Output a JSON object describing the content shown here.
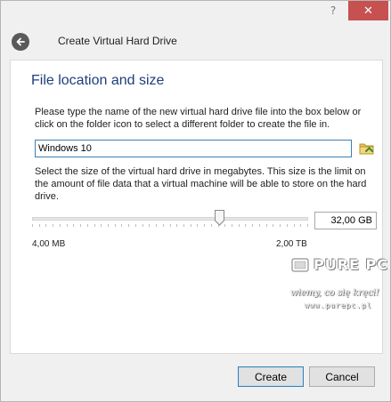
{
  "window": {
    "help_label": "?",
    "close_label": "✕",
    "accent_close": "#c75050"
  },
  "header": {
    "title": "Create Virtual Hard Drive",
    "back_icon": "back-arrow-icon"
  },
  "main": {
    "section_title": "File location and size",
    "file_description": "Please type the name of the new virtual hard drive file into the box below or click on the folder icon to select a different folder to create the file in.",
    "file_name": "Windows 10",
    "folder_icon": "folder-icon",
    "size_description": "Select the size of the virtual hard drive in megabytes. This size is the limit on the amount of file data that a virtual machine will be able to store on the hard drive.",
    "size_value": "32,00 GB",
    "slider_fraction": 0.68,
    "range_min": "4,00 MB",
    "range_max": "2,00 TB"
  },
  "watermark": {
    "brand": "PURE PC",
    "slogan": "wiemy, co się kręci!",
    "url": "www.purepc.pl"
  },
  "buttons": {
    "create": "Create",
    "cancel": "Cancel"
  }
}
